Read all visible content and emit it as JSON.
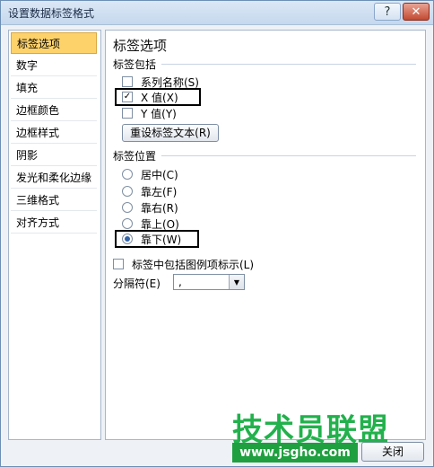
{
  "window": {
    "title": "设置数据标签格式",
    "help_glyph": "?",
    "close_glyph": "✕"
  },
  "sidebar": {
    "items": [
      {
        "label": "标签选项",
        "active": true
      },
      {
        "label": "数字"
      },
      {
        "label": "填充"
      },
      {
        "label": "边框颜色"
      },
      {
        "label": "边框样式"
      },
      {
        "label": "阴影"
      },
      {
        "label": "发光和柔化边缘"
      },
      {
        "label": "三维格式"
      },
      {
        "label": "对齐方式"
      }
    ]
  },
  "panel": {
    "heading": "标签选项",
    "contains_section": "标签包括",
    "checkboxes": [
      {
        "label": "系列名称(S)",
        "checked": false
      },
      {
        "label": "X 值(X)",
        "checked": true
      },
      {
        "label": "Y 值(Y)",
        "checked": false
      }
    ],
    "reset_button": "重设标签文本(R)",
    "position_section": "标签位置",
    "radios": [
      {
        "label": "居中(C)",
        "selected": false
      },
      {
        "label": "靠左(F)",
        "selected": false
      },
      {
        "label": "靠右(R)",
        "selected": false
      },
      {
        "label": "靠上(O)",
        "selected": false
      },
      {
        "label": "靠下(W)",
        "selected": true
      }
    ],
    "legend_key_checkbox": "标签中包括图例项标示(L)",
    "separator_label": "分隔符(E)",
    "separator_value": ",",
    "check_glyph": "✓",
    "dropdown_glyph": "▼"
  },
  "footer": {
    "close_button": "关闭"
  },
  "watermark": {
    "title": "技术员联盟",
    "url": "www.jsgho.com"
  }
}
